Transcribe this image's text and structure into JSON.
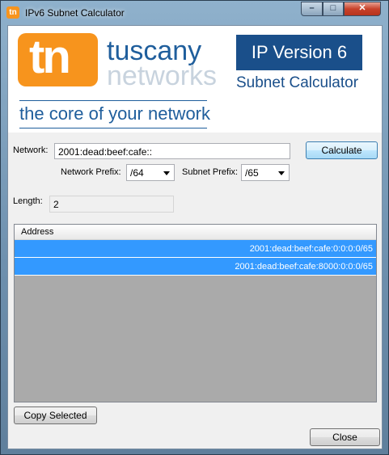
{
  "window": {
    "title": "IPv6 Subnet Calculator",
    "app_icon_text": "tn"
  },
  "titlebar": {
    "min_glyph": "–",
    "max_glyph": "□",
    "close_glyph": "✕"
  },
  "header": {
    "logo_text": "tn",
    "brand_line1": "tuscany",
    "brand_line2": "networks",
    "tagline": "the core of your network",
    "version_label": "IP Version 6",
    "calculator_label": "Subnet Calculator"
  },
  "form": {
    "network_label": "Network:",
    "network_value": "2001:dead:beef:cafe::",
    "calculate_label": "Calculate",
    "network_prefix_label": "Network Prefix:",
    "network_prefix_value": "/64",
    "subnet_prefix_label": "Subnet Prefix:",
    "subnet_prefix_value": "/65",
    "length_label": "Length:",
    "length_value": "2"
  },
  "results": {
    "column_header": "Address",
    "rows": [
      {
        "address": "2001:dead:beef:cafe:0:0:0:0/65"
      },
      {
        "address": "2001:dead:beef:cafe:8000:0:0:0/65"
      }
    ]
  },
  "footer": {
    "copy_label": "Copy Selected",
    "close_label": "Close"
  },
  "colors": {
    "brand_orange": "#f7941d",
    "brand_blue": "#1f5e9c",
    "selection": "#3399ff"
  },
  "icons": [
    "app-logo-icon",
    "minimize-icon",
    "maximize-icon",
    "close-icon",
    "dropdown-arrow-icon"
  ]
}
